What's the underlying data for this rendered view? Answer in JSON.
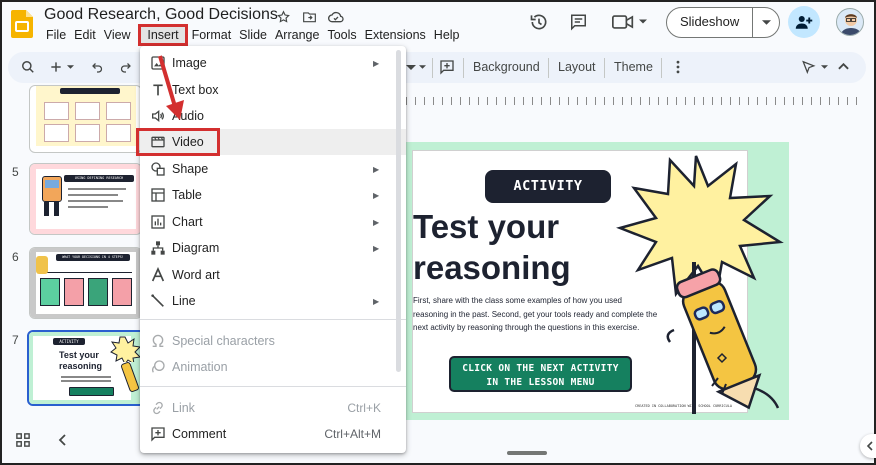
{
  "app": {
    "title": "Good Research, Good Decisions"
  },
  "menubar": {
    "items": [
      "File",
      "Edit",
      "View",
      "Insert",
      "Format",
      "Slide",
      "Arrange",
      "Tools",
      "Extensions",
      "Help"
    ]
  },
  "header": {
    "slideshow_label": "Slideshow"
  },
  "toolbar": {
    "background_label": "Background",
    "layout_label": "Layout",
    "theme_label": "Theme"
  },
  "filmstrip": {
    "slide_numbers": [
      "5",
      "6",
      "7"
    ],
    "thumb7_title_line1": "Test your",
    "thumb7_title_line2": "reasoning",
    "thumb7_badge": "ACTIVITY",
    "thumb5_title": "USING DEFINING RESEARCH",
    "thumb6_title": "WHAT YOUR DECISIONS IN 4 STEPS!"
  },
  "insert_menu": {
    "items": [
      {
        "label": "Image",
        "icon": "image-icon",
        "submenu": true
      },
      {
        "label": "Text box",
        "icon": "text-box-icon",
        "submenu": false
      },
      {
        "label": "Audio",
        "icon": "audio-icon",
        "submenu": false
      },
      {
        "label": "Video",
        "icon": "video-icon",
        "submenu": false,
        "highlighted": true
      },
      {
        "label": "Shape",
        "icon": "shape-icon",
        "submenu": true
      },
      {
        "label": "Table",
        "icon": "table-icon",
        "submenu": true
      },
      {
        "label": "Chart",
        "icon": "chart-icon",
        "submenu": true
      },
      {
        "label": "Diagram",
        "icon": "diagram-icon",
        "submenu": true
      },
      {
        "label": "Word art",
        "icon": "word-art-icon",
        "submenu": false
      },
      {
        "label": "Line",
        "icon": "line-icon",
        "submenu": true
      },
      {
        "label": "Special characters",
        "icon": "omega-icon",
        "disabled": true
      },
      {
        "label": "Animation",
        "icon": "animation-icon",
        "disabled": true
      },
      {
        "label": "Link",
        "icon": "link-icon",
        "disabled": true,
        "shortcut": "Ctrl+K"
      },
      {
        "label": "Comment",
        "icon": "comment-icon",
        "shortcut": "Ctrl+Alt+M"
      }
    ]
  },
  "slide": {
    "badge": "ACTIVITY",
    "title_line1": "Test your",
    "title_line2": "reasoning",
    "body": "First, share with the class some examples of how you used reasoning in the past. Second, get your tools ready and complete the next activity by reasoning through the questions in this exercise.",
    "cta_line1": "CLICK ON THE NEXT ACTIVITY",
    "cta_line2": "IN THE LESSON MENU",
    "credit": "CREATED IN COLLABORATION WITH SCHOOL CURRICULA"
  },
  "colors": {
    "annotation_red": "#d32f2f",
    "badge_dark": "#1d2230",
    "cta_green": "#15805f",
    "slide_bg_mint": "#bff0d4",
    "share_blue": "#c2e7ff"
  }
}
